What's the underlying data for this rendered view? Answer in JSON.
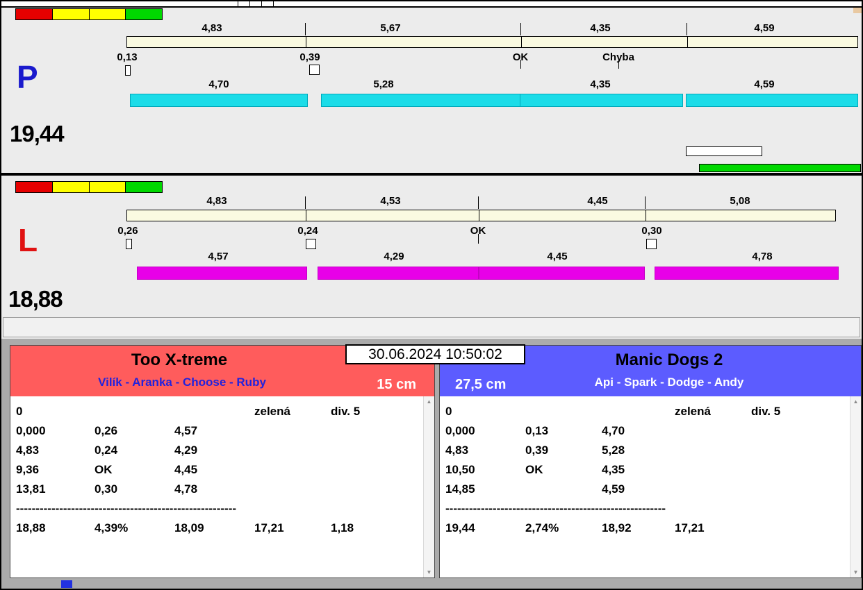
{
  "window": {
    "datetime": "30.06.2024 10:50:02"
  },
  "colors": {
    "light_red": "#e60000",
    "light_yellow": "#ffff00",
    "light_green": "#00d800",
    "lane_p_bar": "#1cdce8",
    "lane_l_bar": "#e800e8",
    "lane_p_letter": "#1a1acd",
    "lane_l_letter": "#e01212",
    "team_left_header": "#ff5c5c",
    "team_right_header": "#5c5cff",
    "progress_green": "#00d800"
  },
  "lane_p": {
    "letter": "P",
    "total": "19,44",
    "splits_top": [
      "4,83",
      "5,67",
      "4,35",
      "4,59"
    ],
    "markers": [
      "0,13",
      "0,39",
      "OK",
      "Chyba"
    ],
    "splits_bottom": [
      "4,70",
      "5,28",
      "4,35",
      "4,59"
    ]
  },
  "lane_l": {
    "letter": "L",
    "total": "18,88",
    "splits_top": [
      "4,83",
      "4,53",
      "4,45",
      "5,08"
    ],
    "markers": [
      "0,26",
      "0,24",
      "OK",
      "0,30"
    ],
    "splits_bottom": [
      "4,57",
      "4,29",
      "4,45",
      "4,78"
    ]
  },
  "team_left": {
    "name": "Too X-treme",
    "dogs": "Vilík - Aranka - Choose - Ruby",
    "dogs_color": "#2222dd",
    "jump_height": "15 cm",
    "rows": [
      [
        "0",
        "",
        "",
        "zelená",
        "div. 5"
      ],
      [
        "0,000",
        "0,26",
        "4,57",
        "",
        ""
      ],
      [
        "4,83",
        "0,24",
        "4,29",
        "",
        ""
      ],
      [
        "9,36",
        "OK",
        "4,45",
        "",
        ""
      ],
      [
        "13,81",
        "0,30",
        "4,78",
        "",
        ""
      ],
      [
        "--------------------------------------------------------",
        "",
        "",
        "",
        ""
      ],
      [
        "18,88",
        "4,39%",
        "18,09",
        "17,21",
        "1,18"
      ]
    ]
  },
  "team_right": {
    "name": "Manic Dogs 2",
    "dogs": "Api - Spark - Dodge - Andy",
    "dogs_color": "#ffffff",
    "jump_height": "27,5 cm",
    "rows": [
      [
        "0",
        "",
        "",
        "zelená",
        "div. 5"
      ],
      [
        "0,000",
        "0,13",
        "4,70",
        "",
        ""
      ],
      [
        "4,83",
        "0,39",
        "5,28",
        "",
        ""
      ],
      [
        "10,50",
        "OK",
        "4,35",
        "",
        ""
      ],
      [
        "14,85",
        "",
        "4,59",
        "",
        ""
      ],
      [
        "--------------------------------------------------------",
        "",
        "",
        "",
        ""
      ],
      [
        "19,44",
        "2,74%",
        "18,92",
        "17,21",
        ""
      ]
    ]
  },
  "icons": {
    "scroll_up": "▲",
    "scroll_down": "▼"
  }
}
